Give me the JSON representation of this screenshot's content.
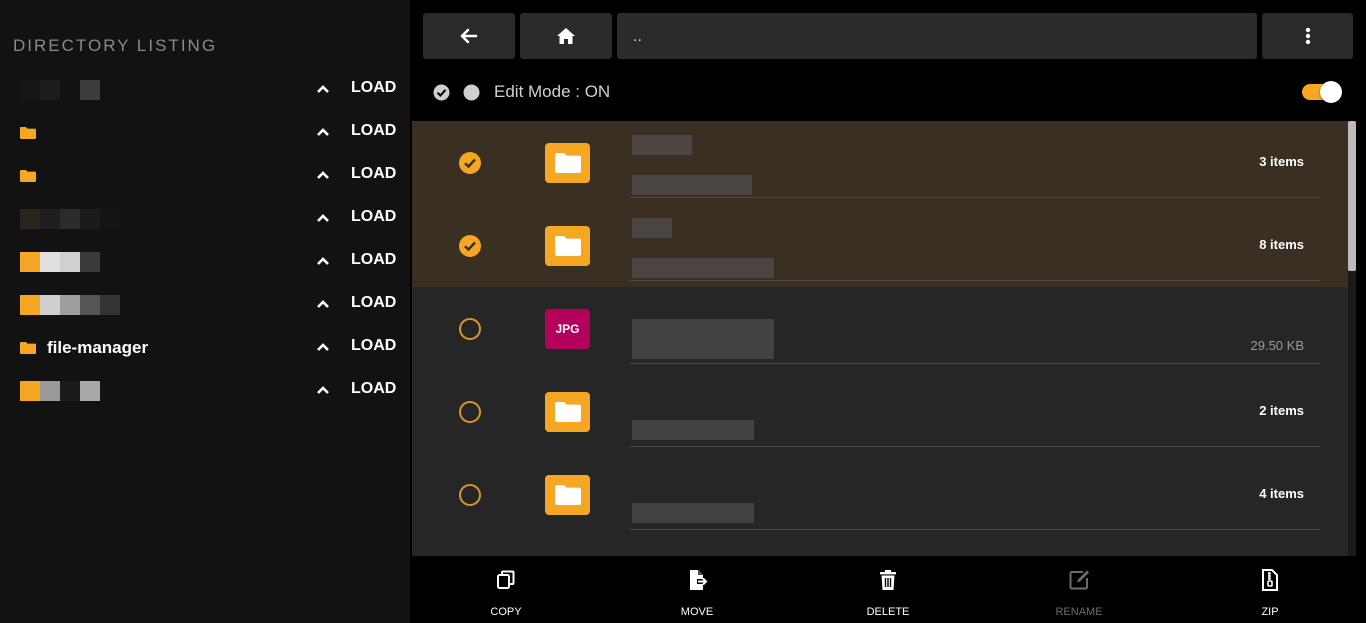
{
  "sidebar": {
    "title": "DIRECTORY LISTING",
    "load_label": "LOAD",
    "items": [
      {
        "label": "",
        "icon": "none"
      },
      {
        "label": "",
        "icon": "folder-icon"
      },
      {
        "label": "",
        "icon": "folder-icon"
      },
      {
        "label": "",
        "icon": "none"
      },
      {
        "label": "",
        "icon": "none"
      },
      {
        "label": "",
        "icon": "none"
      },
      {
        "label": "file-manager",
        "icon": "folder-icon"
      },
      {
        "label": "",
        "icon": "none"
      }
    ]
  },
  "toolbar": {
    "back_icon": "arrow-left-icon",
    "home_icon": "home-icon",
    "path": "..",
    "menu_icon": "vertical-dots-icon"
  },
  "edit_mode": {
    "label": "Edit Mode : ON",
    "enabled": true
  },
  "files": [
    {
      "type": "folder",
      "selected": true,
      "meta": "3 items"
    },
    {
      "type": "folder",
      "selected": true,
      "meta": "8 items"
    },
    {
      "type": "jpg",
      "badge": "JPG",
      "selected": false,
      "meta": "29.50 KB"
    },
    {
      "type": "folder",
      "selected": false,
      "meta": "2 items"
    },
    {
      "type": "folder",
      "selected": false,
      "meta": "4 items"
    }
  ],
  "actions": {
    "copy": "COPY",
    "move": "MOVE",
    "delete": "DELETE",
    "rename": "RENAME",
    "zip": "ZIP"
  },
  "colors": {
    "accent": "#f5a623",
    "selected_row": "#3a2f23",
    "jpg_badge": "#b3005a"
  }
}
